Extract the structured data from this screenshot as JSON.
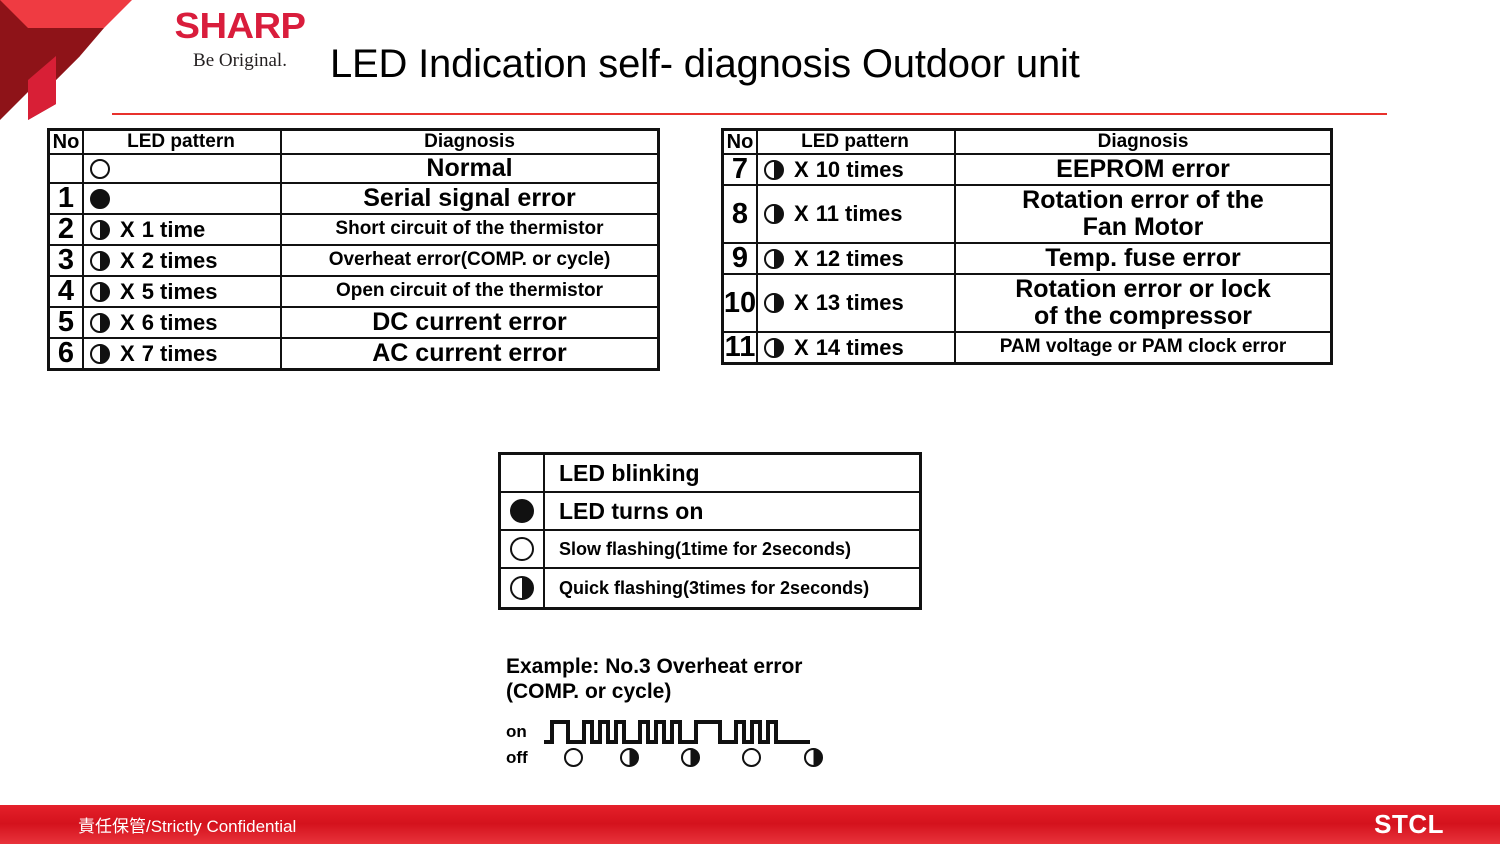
{
  "brand": {
    "wordmark": "SHARP",
    "tagline": "Be Original."
  },
  "header": {
    "title": "LED Indication self- diagnosis Outdoor unit",
    "accent_color": "#e8312c"
  },
  "table_left": {
    "headers": {
      "no": "No",
      "pattern": "LED pattern",
      "diagnosis": "Diagnosis"
    },
    "rows": [
      {
        "no": "",
        "led": "open",
        "count": "",
        "diagnosis": "Normal",
        "size": "big"
      },
      {
        "no": "1",
        "led": "full",
        "count": "",
        "diagnosis": "Serial signal error",
        "size": "big"
      },
      {
        "no": "2",
        "led": "half",
        "count": "1 time",
        "diagnosis": "Short circuit of the thermistor",
        "size": "small"
      },
      {
        "no": "3",
        "led": "half",
        "count": "2 times",
        "diagnosis": "Overheat error(COMP. or cycle)",
        "size": "small"
      },
      {
        "no": "4",
        "led": "half",
        "count": "5 times",
        "diagnosis": "Open circuit of the thermistor",
        "size": "small"
      },
      {
        "no": "5",
        "led": "half",
        "count": "6 times",
        "diagnosis": "DC current error",
        "size": "big"
      },
      {
        "no": "6",
        "led": "half",
        "count": "7 times",
        "diagnosis": "AC current error",
        "size": "big"
      }
    ]
  },
  "table_right": {
    "headers": {
      "no": "No",
      "pattern": "LED pattern",
      "diagnosis": "Diagnosis"
    },
    "rows": [
      {
        "no": "7",
        "led": "half",
        "count": "10 times",
        "diagnosis": "EEPROM error",
        "size": "big"
      },
      {
        "no": "8",
        "led": "half",
        "count": "11 times",
        "diagnosis": "Rotation error of the\nFan Motor",
        "size": "big"
      },
      {
        "no": "9",
        "led": "half",
        "count": "12 times",
        "diagnosis": "Temp. fuse error",
        "size": "big"
      },
      {
        "no": "10",
        "led": "half",
        "count": "13 times",
        "diagnosis": "Rotation error or lock\nof the compressor",
        "size": "big"
      },
      {
        "no": "11",
        "led": "half",
        "count": "14 times",
        "diagnosis": "PAM voltage or PAM clock error",
        "size": "small"
      }
    ]
  },
  "legend": {
    "rows": [
      {
        "led": "blank",
        "label": "LED blinking",
        "size": "big"
      },
      {
        "led": "full",
        "label": "LED turns on",
        "size": "big"
      },
      {
        "led": "open",
        "label": "Slow flashing(1time for 2seconds)",
        "size": "small"
      },
      {
        "led": "half",
        "label": "Quick flashing(3times for 2seconds)",
        "size": "small"
      }
    ]
  },
  "example": {
    "title": "Example: No.3 Overheat error\n(COMP. or cycle)",
    "axis_on": "on",
    "axis_off": "off",
    "markers": [
      "open",
      "half",
      "half",
      "open",
      "half"
    ]
  },
  "footer": {
    "confidential": "責任保管/Strictly Confidential",
    "unit": "STCL",
    "bar_color": "#d4121d"
  }
}
